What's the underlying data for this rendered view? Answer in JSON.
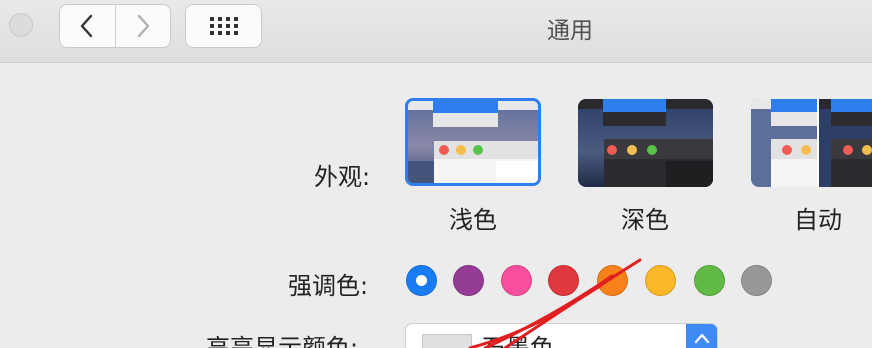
{
  "window": {
    "title": "通用"
  },
  "toolbar": {
    "back_icon": "chevron-left-icon",
    "forward_icon": "chevron-right-icon",
    "grid_icon": "grid-icon"
  },
  "appearance": {
    "label": "外观:",
    "options": [
      {
        "label": "浅色",
        "selected": true
      },
      {
        "label": "深色",
        "selected": false
      },
      {
        "label": "自动",
        "selected": false
      }
    ]
  },
  "accent": {
    "label": "强调色:",
    "colors": [
      "#1a7cf5",
      "#953d96",
      "#f74f9e",
      "#e0383e",
      "#f7821b",
      "#fcb827",
      "#62ba46",
      "#989898"
    ],
    "selected_index": 0
  },
  "highlight": {
    "label": "高亮显示颜色:",
    "value": "石墨色",
    "accent": "#3d8cf6"
  },
  "annotation": {
    "color": "#e02020"
  }
}
